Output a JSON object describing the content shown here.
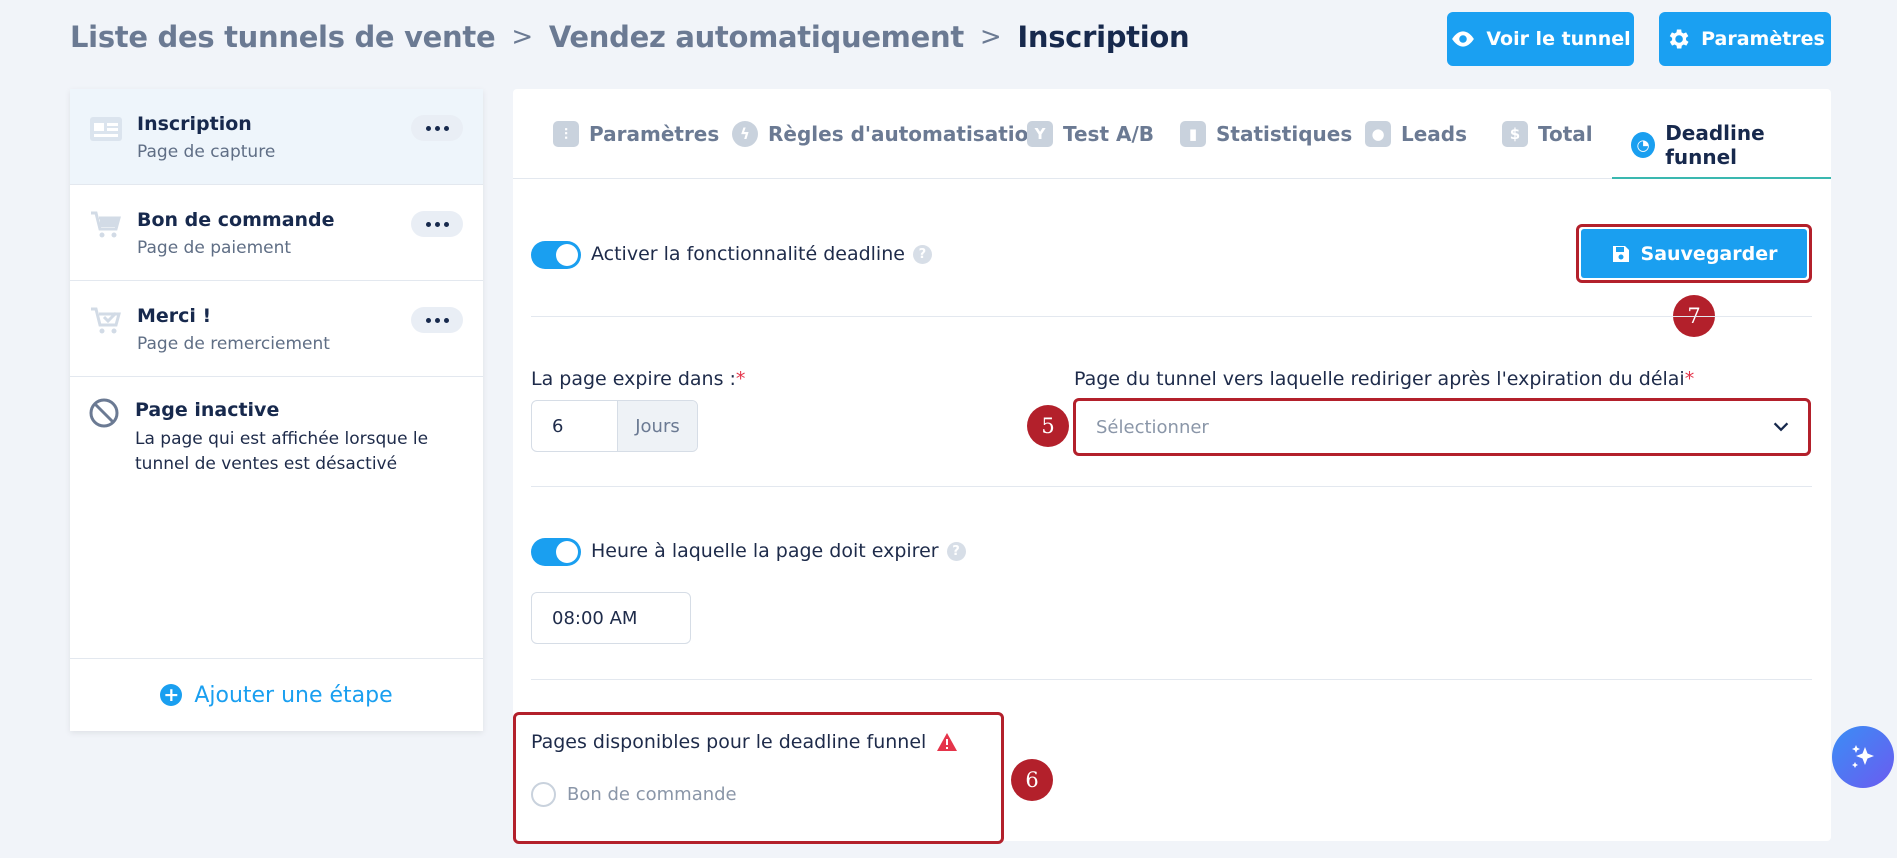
{
  "breadcrumb": {
    "items": [
      "Liste des tunnels de vente",
      "Vendez automatiquement"
    ],
    "separator": ">",
    "current": "Inscription"
  },
  "header": {
    "view_button": "Voir le tunnel",
    "settings_button": "Paramètres"
  },
  "sidebar": {
    "steps": [
      {
        "title": "Inscription",
        "subtitle": "Page de capture",
        "icon": "landing-page-icon"
      },
      {
        "title": "Bon de commande",
        "subtitle": "Page de paiement",
        "icon": "cart-icon"
      },
      {
        "title": "Merci !",
        "subtitle": "Page de remerciement",
        "icon": "cart-check-icon"
      }
    ],
    "inactive": {
      "title": "Page inactive",
      "description": "La page qui est affichée lorsque le tunnel de ventes est désactivé"
    },
    "add_step": "Ajouter une étape"
  },
  "tabs": [
    {
      "label": "Paramètres",
      "icon": "sliders-icon"
    },
    {
      "label": "Règles d'automatisation",
      "icon": "bolt-icon"
    },
    {
      "label": "Test A/B",
      "icon": "split-icon"
    },
    {
      "label": "Statistiques",
      "icon": "bar-chart-icon"
    },
    {
      "label": "Leads",
      "icon": "users-icon"
    },
    {
      "label": "Total",
      "icon": "dollar-icon"
    },
    {
      "label": "Deadline funnel",
      "icon": "clock-icon",
      "active": true
    }
  ],
  "deadline": {
    "enable_label": "Activer la fonctionnalité deadline",
    "enable_on": true,
    "save_label": "Sauvegarder",
    "expire_label": "La page expire dans :",
    "expire_value": "6",
    "expire_unit": "Jours",
    "redirect_label": "Page du tunnel vers laquelle rediriger après l'expiration du délai",
    "redirect_placeholder": "Sélectionner",
    "hour_label": "Heure à laquelle la page doit expirer",
    "hour_on": true,
    "hour_value": "08:00 AM",
    "pages_label": "Pages disponibles pour le deadline funnel",
    "pages_options": [
      "Bon de commande"
    ],
    "required_mark": "*",
    "help_mark": "?"
  },
  "annotations": {
    "select": "5",
    "pages": "6",
    "save": "7"
  },
  "colors": {
    "accent": "#1aa0f2",
    "annotation": "#b3202b",
    "text": "#17294d"
  }
}
